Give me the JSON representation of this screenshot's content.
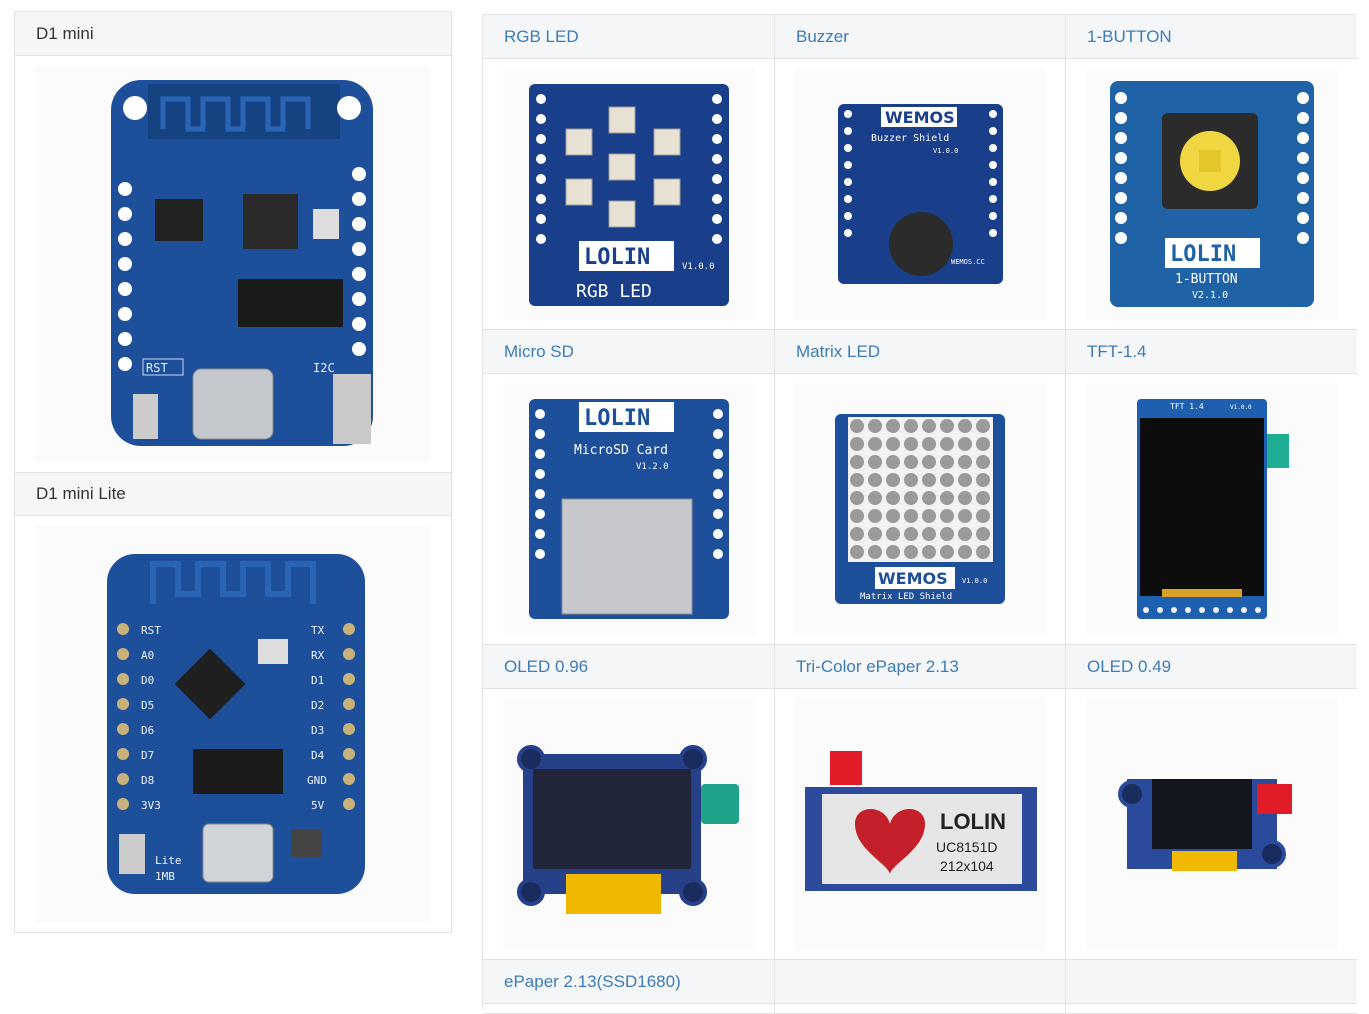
{
  "left": {
    "boards": [
      {
        "title": "D1 mini",
        "icon": "d1-mini-board-image"
      },
      {
        "title": "D1 mini Lite",
        "icon": "d1-mini-lite-board-image"
      }
    ]
  },
  "shields": [
    {
      "title": "RGB LED",
      "icon": "rgb-led-shield-image",
      "silkscreen": [
        "LOLIN",
        "RGB LED",
        "V1.0.0"
      ]
    },
    {
      "title": "Buzzer",
      "icon": "buzzer-shield-image",
      "silkscreen": [
        "WEMOS",
        "Buzzer Shield",
        "V1.0.0",
        "WEMOS.CC"
      ]
    },
    {
      "title": "1-BUTTON",
      "icon": "button-shield-image",
      "silkscreen": [
        "LOLIN",
        "1-BUTTON",
        "V2.1.0"
      ]
    },
    {
      "title": "Micro SD",
      "icon": "micro-sd-shield-image",
      "silkscreen": [
        "LOLIN",
        "MicroSD Card",
        "V1.2.0"
      ]
    },
    {
      "title": "Matrix LED",
      "icon": "matrix-led-shield-image",
      "silkscreen": [
        "WEMOS",
        "Matrix LED Shield",
        "V1.0.0"
      ]
    },
    {
      "title": "TFT-1.4",
      "icon": "tft-display-image",
      "silkscreen": [
        "TFT 1.4",
        "V1.0.0"
      ]
    },
    {
      "title": "OLED 0.96",
      "icon": "oled-096-image",
      "silkscreen": []
    },
    {
      "title": "Tri-Color ePaper 2.13",
      "icon": "epaper-tricolor-image",
      "silkscreen": [
        "LOLIN",
        "UC8151D",
        "212x104"
      ]
    },
    {
      "title": "OLED 0.49",
      "icon": "oled-049-image",
      "silkscreen": []
    },
    {
      "title": "ePaper 2.13(SSD1680)",
      "icon": "epaper-ssd1680-image",
      "silkscreen": []
    },
    {
      "title": "",
      "icon": "",
      "silkscreen": []
    },
    {
      "title": "",
      "icon": "",
      "silkscreen": []
    }
  ],
  "board_silkscreen": {
    "d1_mini": [
      "RST",
      "I2C"
    ],
    "d1_mini_lite": [
      "RST",
      "A0",
      "D0",
      "D5",
      "D6",
      "D7",
      "D8",
      "3V3",
      "TX",
      "RX",
      "D1",
      "D2",
      "D3",
      "D4",
      "GND",
      "5V",
      "Lite",
      "1MB"
    ]
  },
  "colors": {
    "header_bg": "#f4f6f8",
    "link": "#3d7cb8",
    "border": "#dfe3e7",
    "pcb_blue": "#1d4f9a"
  }
}
